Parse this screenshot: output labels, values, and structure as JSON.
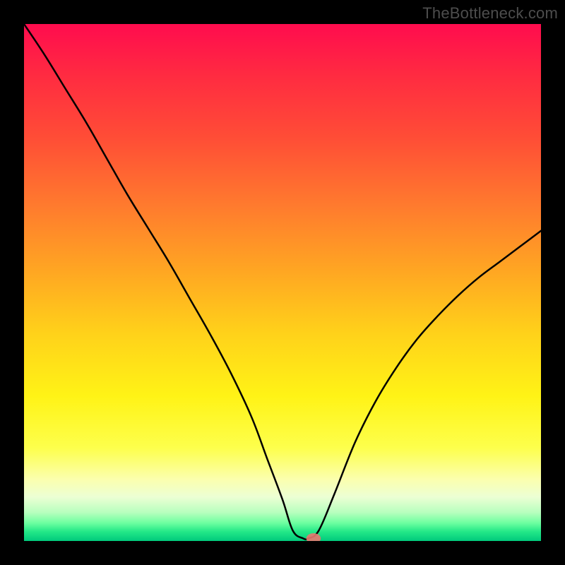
{
  "attribution": "TheBottleneck.com",
  "colors": {
    "background": "#000000",
    "curve": "#000000",
    "marker": "#e87870",
    "gradient_stops": [
      {
        "offset": 0.0,
        "color": "#ff0c4e"
      },
      {
        "offset": 0.1,
        "color": "#ff2b41"
      },
      {
        "offset": 0.22,
        "color": "#ff4d36"
      },
      {
        "offset": 0.35,
        "color": "#ff7a2e"
      },
      {
        "offset": 0.48,
        "color": "#ffa722"
      },
      {
        "offset": 0.6,
        "color": "#ffd21a"
      },
      {
        "offset": 0.72,
        "color": "#fff316"
      },
      {
        "offset": 0.82,
        "color": "#fdff4c"
      },
      {
        "offset": 0.88,
        "color": "#fbffad"
      },
      {
        "offset": 0.915,
        "color": "#ecffd4"
      },
      {
        "offset": 0.945,
        "color": "#b7ffbe"
      },
      {
        "offset": 0.965,
        "color": "#6effa0"
      },
      {
        "offset": 0.982,
        "color": "#23e888"
      },
      {
        "offset": 1.0,
        "color": "#00c97c"
      }
    ]
  },
  "chart_data": {
    "type": "line",
    "title": "",
    "xlabel": "",
    "ylabel": "",
    "xlim": [
      0,
      100
    ],
    "ylim": [
      0,
      100
    ],
    "grid": false,
    "legend": false,
    "annotations": [],
    "series": [
      {
        "name": "bottleneck-curve",
        "x": [
          0,
          4,
          8,
          12,
          16,
          20,
          24,
          28,
          32,
          36,
          40,
          44,
          47,
          50,
          52,
          54,
          55,
          57,
          60,
          64,
          68,
          72,
          76,
          80,
          84,
          88,
          92,
          96,
          100
        ],
        "values": [
          100,
          94,
          87.5,
          81,
          74,
          67,
          60.5,
          54,
          47,
          40,
          32.5,
          24,
          16,
          8,
          2,
          0.5,
          0.5,
          2,
          9,
          19,
          27,
          33.5,
          39,
          43.5,
          47.5,
          51,
          54,
          57,
          60
        ]
      }
    ],
    "marker": {
      "x": 56,
      "y": 0.5,
      "rx": 1.4,
      "ry": 1.0
    }
  }
}
